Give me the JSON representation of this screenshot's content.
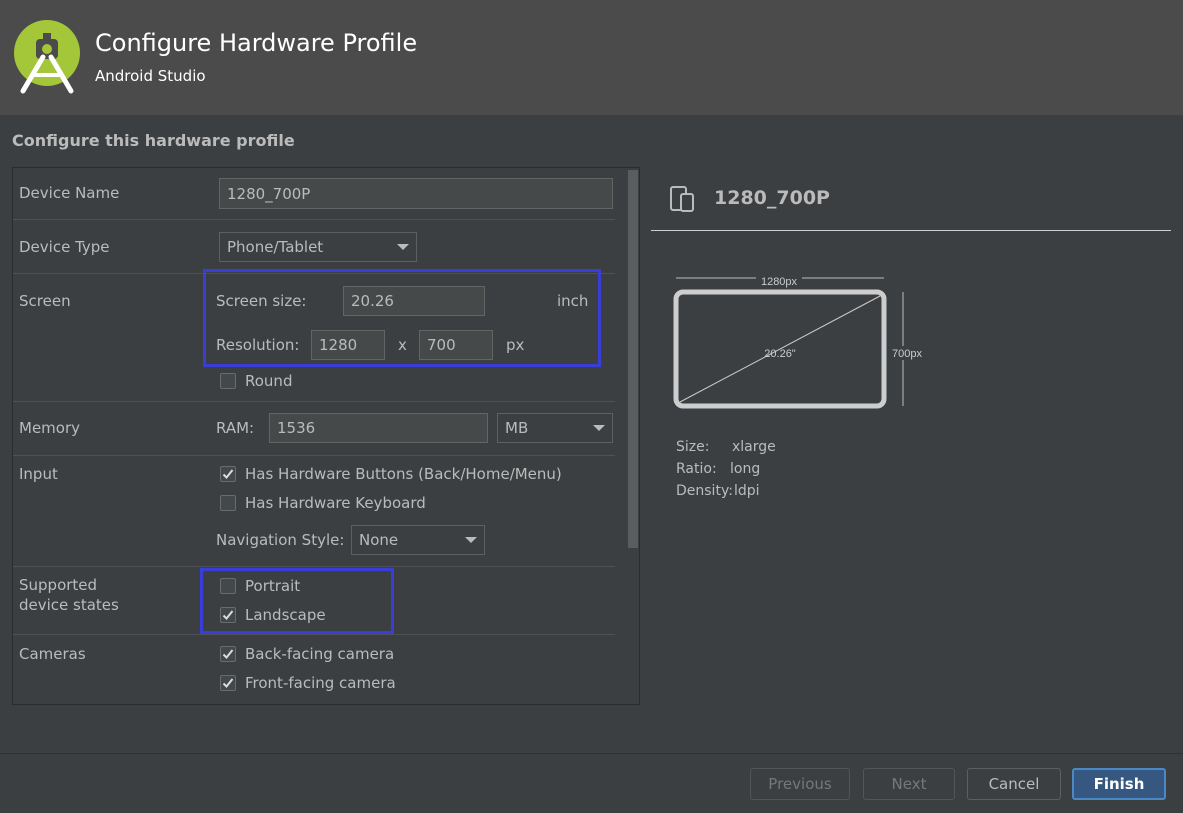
{
  "colors": {
    "accent": "#3a3ed8",
    "primary_button": "#365880",
    "logo_green": "#a4c639"
  },
  "header": {
    "title": "Configure Hardware Profile",
    "subtitle": "Android Studio",
    "logo_icon": "android-studio-logo-icon"
  },
  "section_heading": "Configure this hardware profile",
  "form": {
    "device_name": {
      "label": "Device Name",
      "value": "1280_700P"
    },
    "device_type": {
      "label": "Device Type",
      "value": "Phone/Tablet"
    },
    "screen": {
      "label": "Screen",
      "size_label": "Screen size:",
      "size_value": "20.26",
      "size_unit": "inch",
      "resolution_label": "Resolution:",
      "res_x": "1280",
      "res_sep": "x",
      "res_y": "700",
      "res_unit": "px",
      "round_label": "Round",
      "round_checked": false
    },
    "memory": {
      "label": "Memory",
      "ram_label": "RAM:",
      "ram_value": "1536",
      "ram_unit": "MB"
    },
    "input": {
      "label": "Input",
      "hw_buttons_label": "Has Hardware Buttons (Back/Home/Menu)",
      "hw_buttons_checked": true,
      "hw_keyboard_label": "Has Hardware Keyboard",
      "hw_keyboard_checked": false,
      "nav_style_label": "Navigation Style:",
      "nav_style_value": "None"
    },
    "device_states": {
      "label_line1": "Supported",
      "label_line2": "device states",
      "portrait_label": "Portrait",
      "portrait_checked": false,
      "landscape_label": "Landscape",
      "landscape_checked": true
    },
    "cameras": {
      "label": "Cameras",
      "back_label": "Back-facing camera",
      "back_checked": true,
      "front_label": "Front-facing camera",
      "front_checked": true
    }
  },
  "preview": {
    "device_icon": "device-icon",
    "name": "1280_700P",
    "width_label": "1280px",
    "height_label": "700px",
    "diagonal_label": "20.26\"",
    "size_label": "Size:",
    "size_value": "xlarge",
    "ratio_label": "Ratio:",
    "ratio_value": "long",
    "density_label": "Density:",
    "density_value": "ldpi"
  },
  "footer": {
    "previous": "Previous",
    "next": "Next",
    "cancel": "Cancel",
    "finish": "Finish"
  }
}
